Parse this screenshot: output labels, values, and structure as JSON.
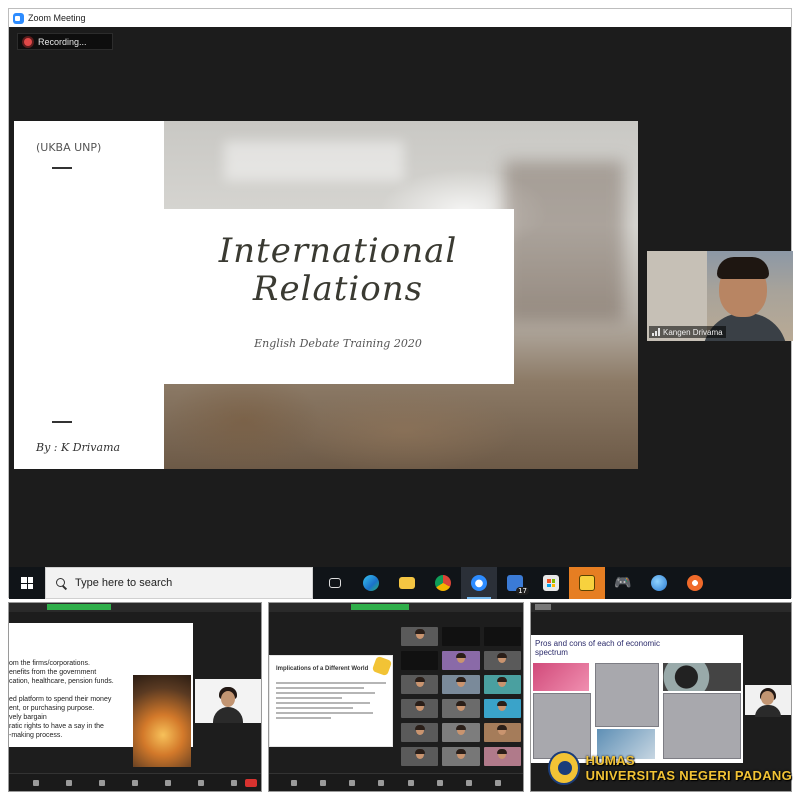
{
  "window": {
    "title": "Zoom Meeting"
  },
  "recording": {
    "label": "Recording..."
  },
  "slide": {
    "org": "(UKBA UNP)",
    "title_line1": "International",
    "title_line2": "Relations",
    "subtitle": "English Debate Training 2020",
    "byline": "By : K Drivama"
  },
  "speaker": {
    "name": "Kangen Drivama"
  },
  "taskbar": {
    "search_placeholder": "Type here to search",
    "badge_count": "17",
    "icons": [
      "task-view-icon",
      "edge-icon",
      "file-explorer-icon",
      "chrome-icon",
      "zoom-icon",
      "mail-icon",
      "store-icon",
      "sticky-notes-icon",
      "game-controller-icon",
      "browser-globe-icon",
      "media-player-icon"
    ]
  },
  "thumb1": {
    "lines": [
      "om the firms/corporations.",
      "enefits from the government",
      "cation, healthcare, pension funds.",
      "",
      "ed platform to spend their money",
      "ent, or purchasing purpose.",
      "vely bargain",
      "ratic rights to have a say in the",
      "-making process."
    ]
  },
  "thumb2": {
    "slide_heading": "Implications of a Different World"
  },
  "thumb3": {
    "slide_title": "Pros and cons of each of economic spectrum"
  },
  "watermark": {
    "line1": "HUMAS",
    "line2": "UNIVERSITAS NEGERI PADANG"
  },
  "colors": {
    "accent_zoom": "#2d8cff",
    "recording_red": "#e04848",
    "taskbar": "#101418",
    "watermark_gold": "#f2c335"
  }
}
